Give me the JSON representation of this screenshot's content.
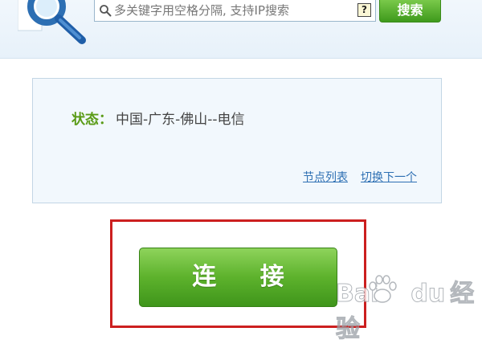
{
  "search": {
    "placeholder": "多关键字用空格分隔, 支持IP搜索",
    "help_glyph": "?",
    "button_label": "搜索"
  },
  "status_panel": {
    "label": "状态：",
    "value": "中国-广东-佛山--电信",
    "links": [
      "节点列表",
      "切换下一个"
    ]
  },
  "connect": {
    "label": "连 接"
  },
  "watermark": {
    "brand": "Bai",
    "brand_suffix": "du",
    "text": "经验"
  },
  "colors": {
    "accent_green": "#5db22c",
    "status_label_green": "#5a9b16",
    "link_blue": "#2d6fb3",
    "highlight_red": "#cc1f1f",
    "panel_bg": "#f2f8fd"
  },
  "icons": {
    "logo": "magnifier-logo-icon",
    "search": "search-icon",
    "help": "help-icon",
    "watermark": "baidu-paw-icon"
  }
}
